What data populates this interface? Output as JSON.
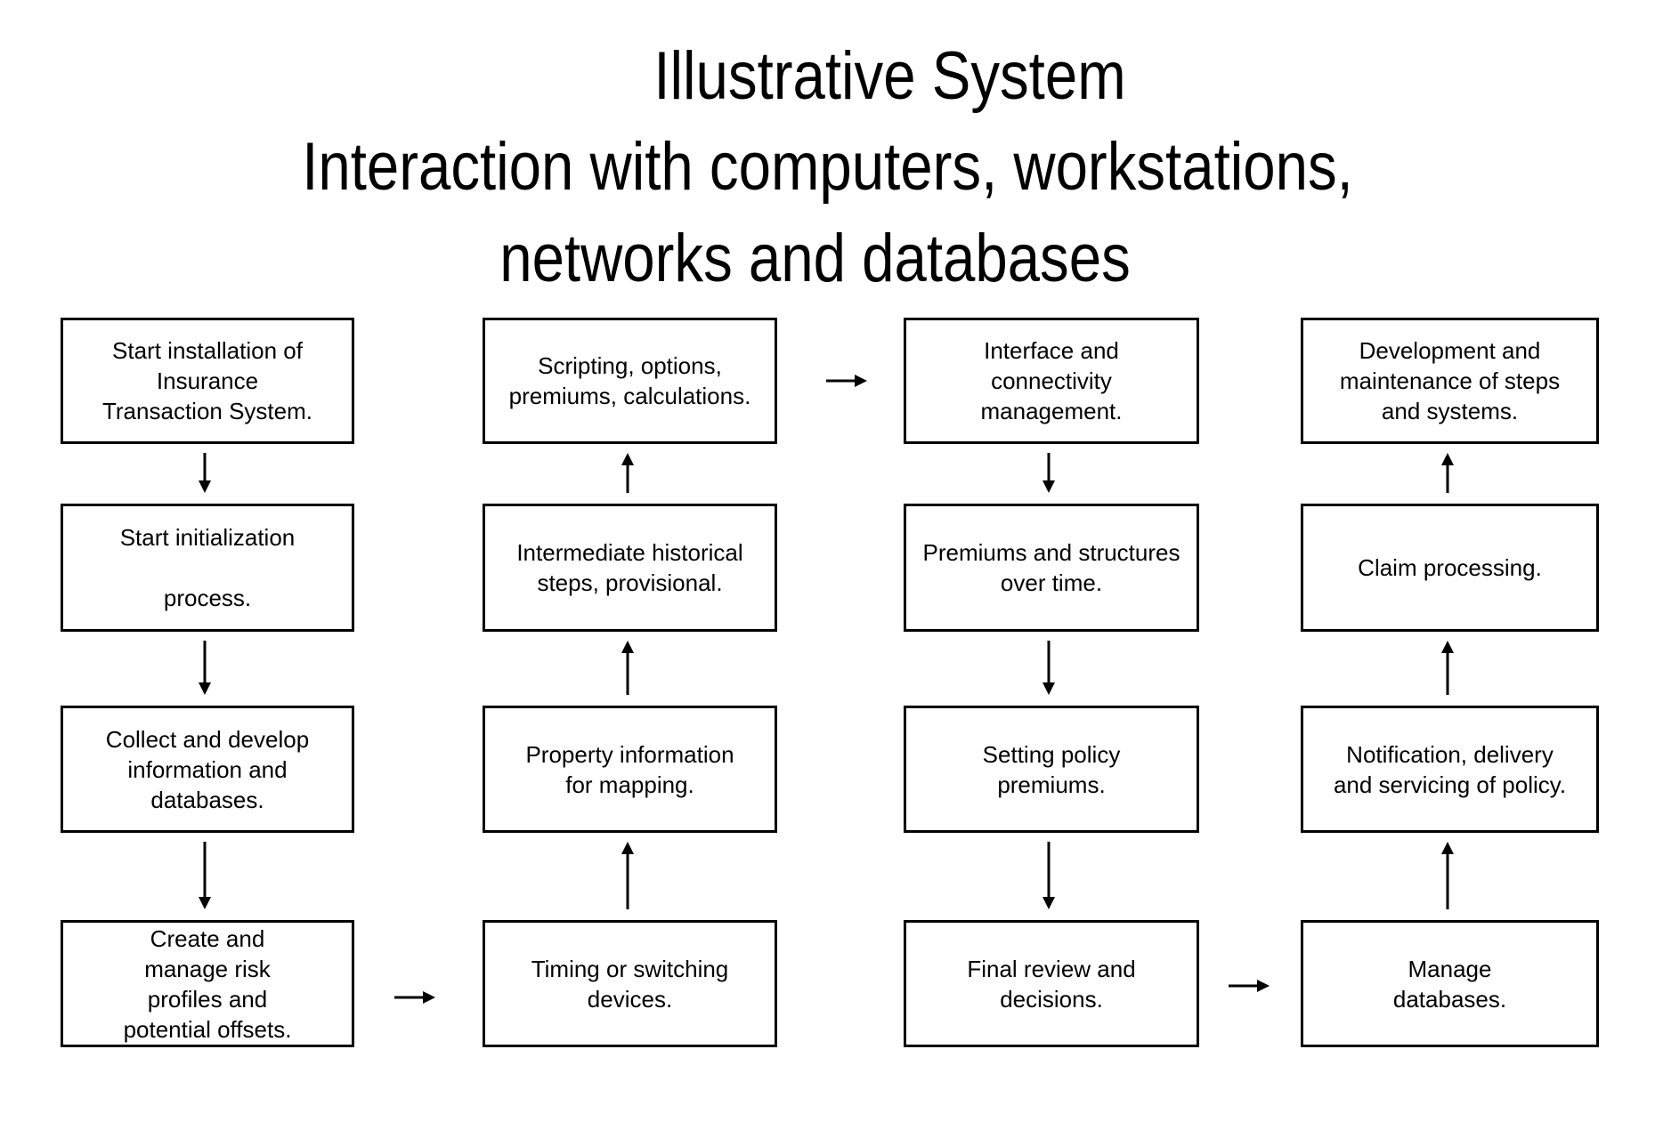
{
  "title": {
    "line1": "Illustrative System",
    "line2": "Interaction with computers, workstations,",
    "line3": "networks and databases"
  },
  "columns": [
    {
      "boxes": [
        "Start installation of\nInsurance\nTransaction System.",
        "Start initialization\n\nprocess.",
        "Collect and develop\ninformation and\ndatabases.",
        "Create and\nmanage risk\nprofiles and\npotential offsets."
      ],
      "flow": "down"
    },
    {
      "boxes": [
        "Scripting, options,\npremiums, calculations.",
        "Intermediate historical\nsteps, provisional.",
        "Property information\nfor mapping.",
        "Timing or switching\ndevices."
      ],
      "flow": "up"
    },
    {
      "boxes": [
        "Interface and\nconnectivity\nmanagement.",
        "Premiums and structures\nover time.",
        "Setting policy\npremiums.",
        "Final review and\ndecisions."
      ],
      "flow": "down"
    },
    {
      "boxes": [
        "Development and\nmaintenance of steps\nand systems.",
        "Claim processing.",
        "Notification, delivery\nand servicing of policy.",
        "Manage\ndatabases."
      ],
      "flow": "up"
    }
  ],
  "connectors": [
    {
      "from": "column-1-row-4",
      "to": "column-2-row-4",
      "direction": "right"
    },
    {
      "from": "column-2-row-1",
      "to": "column-3-row-1",
      "direction": "right"
    },
    {
      "from": "column-3-row-4",
      "to": "column-4-row-4",
      "direction": "right"
    }
  ]
}
